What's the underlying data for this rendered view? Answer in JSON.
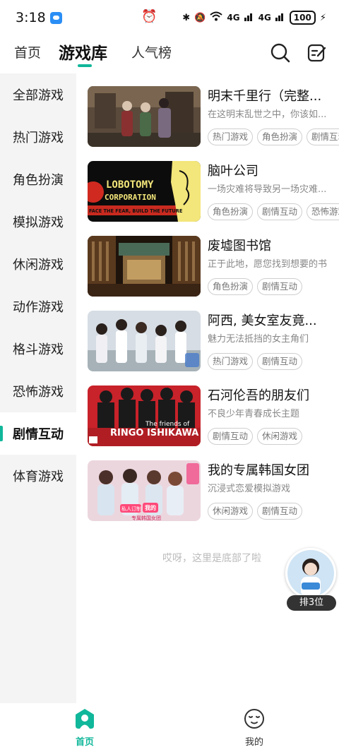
{
  "status_bar": {
    "time": "3:18",
    "signal_1": "4G",
    "signal_2": "4G",
    "battery": "100"
  },
  "top_nav": {
    "tabs": [
      {
        "label": "首页"
      },
      {
        "label": "游戏库"
      },
      {
        "label": "人气榜"
      }
    ],
    "active_tab": "游戏库",
    "accent_color": "#11b79a"
  },
  "sidebar": {
    "items": [
      {
        "label": "全部游戏"
      },
      {
        "label": "热门游戏"
      },
      {
        "label": "角色扮演"
      },
      {
        "label": "模拟游戏"
      },
      {
        "label": "休闲游戏"
      },
      {
        "label": "动作游戏"
      },
      {
        "label": "格斗游戏"
      },
      {
        "label": "恐怖游戏"
      },
      {
        "label": "剧情互动"
      },
      {
        "label": "体育游戏"
      }
    ],
    "active": "剧情互动"
  },
  "games": [
    {
      "title": "明末千里行（完整...",
      "desc": "在这明末乱世之中，你该如...",
      "tags": [
        "热门游戏",
        "角色扮演",
        "剧情互动"
      ]
    },
    {
      "title": "脑叶公司",
      "desc": "一场灾难将导致另一场灾难...",
      "tags": [
        "角色扮演",
        "剧情互动",
        "恐怖游戏"
      ],
      "thumb_text_1": "LOBOTOMY",
      "thumb_text_2": "CORPORATION",
      "thumb_text_3": "FACE THE FEAR, BUILD THE FUTURE"
    },
    {
      "title": "废墟图书馆",
      "desc": "正于此地，愿您找到想要的书",
      "tags": [
        "角色扮演",
        "剧情互动"
      ]
    },
    {
      "title": "阿西, 美女室友竟...",
      "desc": "魅力无法抵挡的女主角们",
      "tags": [
        "热门游戏",
        "剧情互动"
      ]
    },
    {
      "title": "石河伦吾的朋友们",
      "desc": "不良少年青春成长主题",
      "tags": [
        "剧情互动",
        "休闲游戏"
      ],
      "thumb_text_1": "The friends of",
      "thumb_text_2": "RINGO ISHIKAWA"
    },
    {
      "title": "我的专属韩国女团",
      "desc": "沉浸式恋爱模拟游戏",
      "tags": [
        "休闲游戏",
        "剧情互动"
      ],
      "thumb_text_1": "私人订制",
      "thumb_text_2": "我的",
      "thumb_text_3": "专属韩国女团"
    }
  ],
  "bottom_note": "哎呀，这里是底部了啦",
  "float_rank": {
    "label": "排3位"
  },
  "bottom_nav": [
    {
      "label": "首页",
      "icon": "home-icon"
    },
    {
      "label": "我的",
      "icon": "face-icon"
    }
  ]
}
